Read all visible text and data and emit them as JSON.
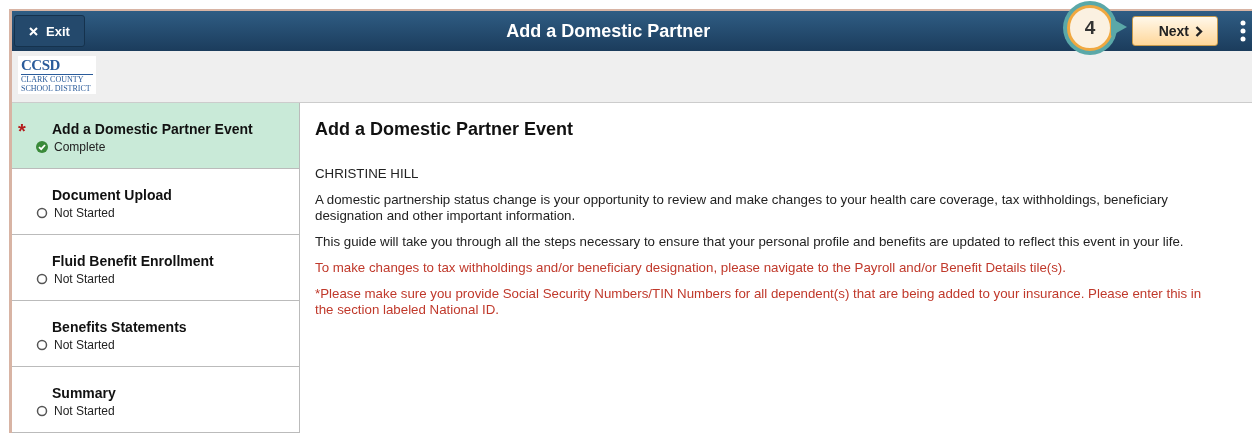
{
  "header": {
    "exit_label": "Exit",
    "title": "Add a Domestic Partner",
    "next_label": "Next",
    "callout": "4"
  },
  "logo": {
    "name": "CCSD",
    "subtitle": "CLARK COUNTY SCHOOL DISTRICT"
  },
  "steps": [
    {
      "label": "Add a Domestic Partner Event",
      "status": "Complete",
      "complete": true,
      "required_mark": "*",
      "selected": true
    },
    {
      "label": "Document Upload",
      "status": "Not Started",
      "complete": false,
      "selected": false
    },
    {
      "label": "Fluid Benefit Enrollment",
      "status": "Not Started",
      "complete": false,
      "selected": false
    },
    {
      "label": "Benefits Statements",
      "status": "Not Started",
      "complete": false,
      "selected": false
    },
    {
      "label": "Summary",
      "status": "Not Started",
      "complete": false,
      "selected": false
    }
  ],
  "content": {
    "heading": "Add a Domestic Partner Event",
    "paragraphs": [
      {
        "kind": "normal",
        "text": "CHRISTINE HILL"
      },
      {
        "kind": "normal",
        "text": "A domestic partnership status change is your opportunity to review and make changes to your health care coverage, tax withholdings, beneficiary designation and other important information."
      },
      {
        "kind": "normal",
        "text": "This guide will take you through all the steps necessary to ensure that your personal profile and benefits are updated to reflect this event in your life."
      },
      {
        "kind": "notice",
        "text": "To make changes to tax withholdings and/or beneficiary designation, please navigate to the Payroll and/or Benefit Details tile(s)."
      },
      {
        "kind": "notice",
        "text": "*Please make sure you provide Social Security Numbers/TIN Numbers for all dependent(s) that are being added to your insurance. Please enter this in the section labeled National ID."
      }
    ]
  }
}
